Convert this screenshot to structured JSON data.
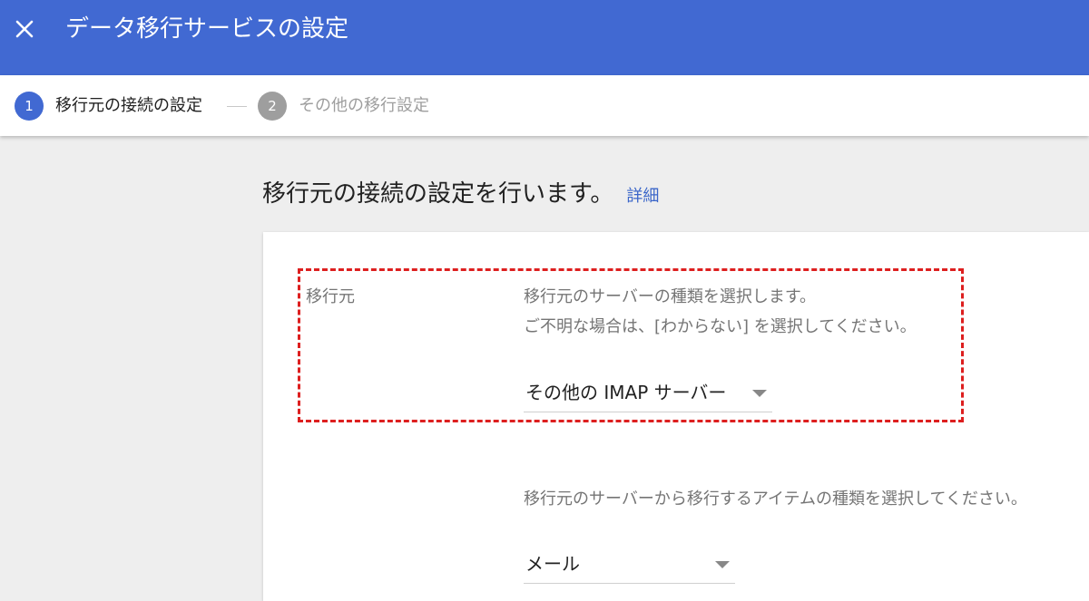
{
  "appbar": {
    "title": "データ移行サービスの設定"
  },
  "stepper": {
    "steps": [
      {
        "number": "1",
        "label": "移行元の接続の設定",
        "state": "active"
      },
      {
        "number": "2",
        "label": "その他の移行設定",
        "state": "inactive"
      }
    ]
  },
  "main": {
    "heading": "移行元の接続の設定を行います。",
    "details_link": "詳細"
  },
  "source": {
    "label": "移行元",
    "help_line1": "移行元のサーバーの種類を選択します。",
    "help_line2": "ご不明な場合は、[わからない] を選択してください。",
    "server_type_value": "その他の IMAP サーバー"
  },
  "items": {
    "help": "移行元のサーバーから移行するアイテムの種類を選択してください。",
    "item_type_value": "メール"
  },
  "colors": {
    "appbar_bg": "#4169d2",
    "accent": "#4169d2",
    "highlight": "#dd1f1f",
    "link": "#3b66c9"
  },
  "icons": {
    "close": "close-icon",
    "dropdown": "dropdown-arrow-icon"
  }
}
